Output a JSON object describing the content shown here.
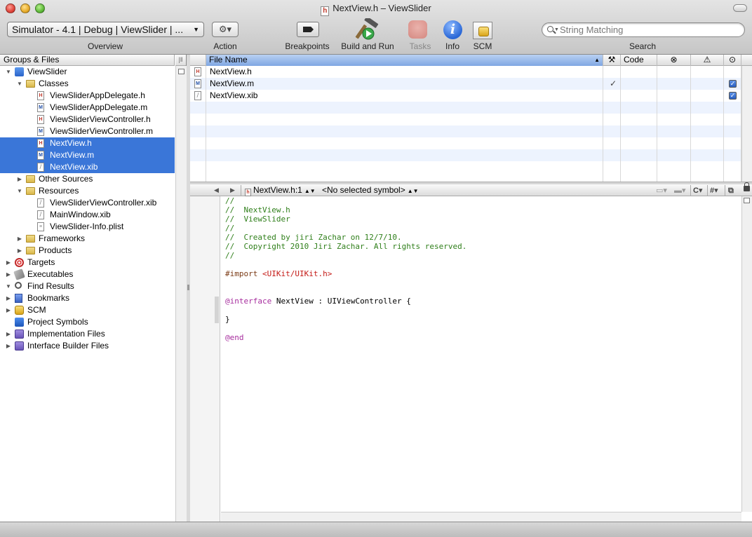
{
  "window": {
    "title": "NextView.h – ViewSlider",
    "doc_badge": "h"
  },
  "toolbar": {
    "overview_value": "Simulator - 4.1 | Debug | ViewSlider | ...",
    "overview_label": "Overview",
    "action_label": "Action",
    "breakpoints_label": "Breakpoints",
    "build_run_label": "Build and Run",
    "tasks_label": "Tasks",
    "info_label": "Info",
    "scm_label": "SCM",
    "search_placeholder": "String Matching",
    "search_label": "Search"
  },
  "sidebar": {
    "header": "Groups & Files",
    "items": [
      {
        "label": "ViewSlider",
        "depth": 0,
        "icon": "project-icon",
        "disclosure": "open",
        "selected": false
      },
      {
        "label": "Classes",
        "depth": 1,
        "icon": "folder-icon",
        "disclosure": "open",
        "selected": false
      },
      {
        "label": "ViewSliderAppDelegate.h",
        "depth": 2,
        "icon": "header-file-icon",
        "disclosure": "none",
        "selected": false
      },
      {
        "label": "ViewSliderAppDelegate.m",
        "depth": 2,
        "icon": "implementation-file-icon",
        "disclosure": "none",
        "selected": false
      },
      {
        "label": "ViewSliderViewController.h",
        "depth": 2,
        "icon": "header-file-icon",
        "disclosure": "none",
        "selected": false
      },
      {
        "label": "ViewSliderViewController.m",
        "depth": 2,
        "icon": "implementation-file-icon",
        "disclosure": "none",
        "selected": false
      },
      {
        "label": "NextView.h",
        "depth": 2,
        "icon": "header-file-icon",
        "disclosure": "none",
        "selected": true
      },
      {
        "label": "NextView.m",
        "depth": 2,
        "icon": "implementation-file-icon",
        "disclosure": "none",
        "selected": true
      },
      {
        "label": "NextView.xib",
        "depth": 2,
        "icon": "xib-file-icon",
        "disclosure": "none",
        "selected": true
      },
      {
        "label": "Other Sources",
        "depth": 1,
        "icon": "folder-icon",
        "disclosure": "closed",
        "selected": false
      },
      {
        "label": "Resources",
        "depth": 1,
        "icon": "folder-icon",
        "disclosure": "open",
        "selected": false
      },
      {
        "label": "ViewSliderViewController.xib",
        "depth": 2,
        "icon": "xib-file-icon",
        "disclosure": "none",
        "selected": false
      },
      {
        "label": "MainWindow.xib",
        "depth": 2,
        "icon": "xib-file-icon",
        "disclosure": "none",
        "selected": false
      },
      {
        "label": "ViewSlider-Info.plist",
        "depth": 2,
        "icon": "plist-file-icon",
        "disclosure": "none",
        "selected": false
      },
      {
        "label": "Frameworks",
        "depth": 1,
        "icon": "folder-icon",
        "disclosure": "closed",
        "selected": false
      },
      {
        "label": "Products",
        "depth": 1,
        "icon": "folder-icon",
        "disclosure": "closed",
        "selected": false
      },
      {
        "label": "Targets",
        "depth": 0,
        "icon": "target-icon",
        "disclosure": "closed",
        "selected": false
      },
      {
        "label": "Executables",
        "depth": 0,
        "icon": "executable-icon",
        "disclosure": "closed",
        "selected": false
      },
      {
        "label": "Find Results",
        "depth": 0,
        "icon": "find-icon",
        "disclosure": "open",
        "selected": false
      },
      {
        "label": "Bookmarks",
        "depth": 0,
        "icon": "bookmark-icon",
        "disclosure": "closed",
        "selected": false
      },
      {
        "label": "SCM",
        "depth": 0,
        "icon": "scm-icon",
        "disclosure": "closed",
        "selected": false
      },
      {
        "label": "Project Symbols",
        "depth": 0,
        "icon": "symbols-icon",
        "disclosure": "none",
        "selected": false
      },
      {
        "label": "Implementation Files",
        "depth": 0,
        "icon": "smart-group-icon",
        "disclosure": "closed",
        "selected": false
      },
      {
        "label": "Interface Builder Files",
        "depth": 0,
        "icon": "smart-group-icon",
        "disclosure": "closed",
        "selected": false
      }
    ]
  },
  "filelist": {
    "columns": {
      "name": "File Name",
      "built": "⚒",
      "code": "Code",
      "errors": "⊗",
      "warnings": "⚠",
      "target": "⊙"
    },
    "rows": [
      {
        "name": "NextView.h",
        "icon": "header-file-icon",
        "built": "",
        "in_target": false
      },
      {
        "name": "NextView.m",
        "icon": "implementation-file-icon",
        "built": "✓",
        "in_target": true
      },
      {
        "name": "NextView.xib",
        "icon": "xib-file-icon",
        "built": "",
        "in_target": true
      }
    ]
  },
  "editor": {
    "file_popup": "NextView.h:1",
    "symbol_popup": "<No selected symbol>",
    "nav_right": [
      "C",
      "#"
    ],
    "lines": [
      [
        {
          "t": "//",
          "c": "c-comment"
        }
      ],
      [
        {
          "t": "//  NextView.h",
          "c": "c-comment"
        }
      ],
      [
        {
          "t": "//  ViewSlider",
          "c": "c-comment"
        }
      ],
      [
        {
          "t": "//",
          "c": "c-comment"
        }
      ],
      [
        {
          "t": "//  Created by jiri Zachar on 12/7/10.",
          "c": "c-comment"
        }
      ],
      [
        {
          "t": "//  Copyright 2010 Jiri Zachar. All rights reserved.",
          "c": "c-comment"
        }
      ],
      [
        {
          "t": "//",
          "c": "c-comment"
        }
      ],
      [],
      [
        {
          "t": "#import ",
          "c": "c-pre"
        },
        {
          "t": "<UIKit/UIKit.h>",
          "c": "c-pre inc"
        }
      ],
      [],
      [],
      [
        {
          "t": "@interface",
          "c": "c-kw"
        },
        {
          "t": " NextView : UIViewController {",
          "c": ""
        }
      ],
      [],
      [
        {
          "t": "}",
          "c": ""
        }
      ],
      [],
      [
        {
          "t": "@end",
          "c": "c-kw"
        }
      ]
    ]
  }
}
